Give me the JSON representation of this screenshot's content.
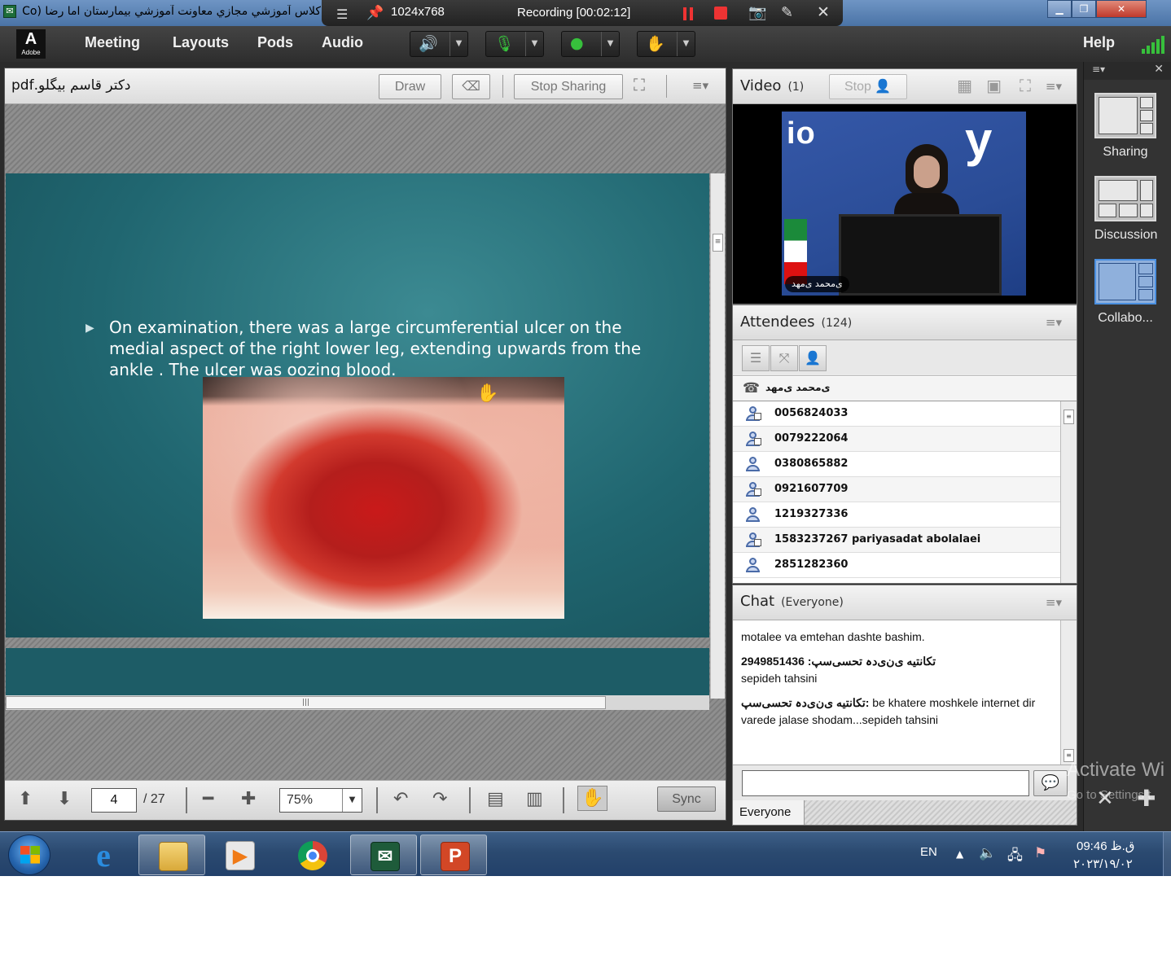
{
  "window": {
    "title": "كلاس آموزشي مجازي معاونت آموزشي بيمارستان اما رضا (Co",
    "controls": [
      "minimize",
      "maximize",
      "close"
    ]
  },
  "recorder": {
    "resolution": "1024x768",
    "status": "Recording [00:02:12]"
  },
  "menubar": {
    "logo_text": "Adobe",
    "items": [
      "Meeting",
      "Layouts",
      "Pods",
      "Audio"
    ],
    "help": "Help",
    "speaker_color": "#37c03c",
    "mic_color": "#37c03c",
    "camera_color": "#37c03c"
  },
  "share": {
    "title": "دکتر قاسم بیگلو.pdf",
    "draw_label": "Draw",
    "stop_sharing_label": "Stop Sharing",
    "slide_text": "On examination, there was a large circumferential ulcer on the medial aspect of the right lower leg, extending upwards from the ankle . The ulcer was oozing blood.",
    "page": "4",
    "page_total": "/ 27",
    "zoom": "75%",
    "sync_label": "Sync"
  },
  "video": {
    "title": "Video",
    "count": "(1)",
    "stop_label": "Stop",
    "feed_logo": "io",
    "feed_logo2": "y",
    "presenter_name": "ی‌محمد ی‌مهد"
  },
  "attendees": {
    "title": "Attendees",
    "count": "(124)",
    "presenter": "ی‌محمد ی‌مهد",
    "list": [
      {
        "name": "0056824033",
        "camera": true
      },
      {
        "name": "0079222064",
        "camera": true
      },
      {
        "name": "0380865882",
        "camera": false
      },
      {
        "name": "0921607709",
        "camera": true
      },
      {
        "name": "1219327336",
        "camera": false
      },
      {
        "name": "1583237267 pariyasadat abolalaei",
        "camera": true
      },
      {
        "name": "2851282360",
        "camera": false
      }
    ]
  },
  "chat": {
    "title": "Chat",
    "scope": "(Everyone)",
    "messages": [
      {
        "who": "",
        "text": "motalee va emtehan dashte bashim."
      },
      {
        "who": "سپی‌دہ تحسی‌نی 2949851436",
        "text": "سپی‌دہ تحسی‌نی: تکانتیه sepideh tahsini",
        "line1": "تکانتیه ی‌ن‌ی‌دہ تحسی‌سپ: 2949851436",
        "line2": "sepideh tahsini"
      },
      {
        "who": "تکانتیه ی‌ن‌ی‌دہ تحسی‌سپ:",
        "text": "be khatere moshkele internet dir varede jalase shodam...sepideh tahsini"
      }
    ],
    "target": "Everyone"
  },
  "layouts": {
    "items": [
      "Sharing",
      "Discussion",
      "Collabo..."
    ],
    "selected": 2
  },
  "watermark": {
    "line1": "Activate Wi",
    "line2": "Go to Settings t"
  },
  "taskbar": {
    "lang": "EN",
    "time": "09:46 ق.ظ",
    "date": "۲۰۲۳/۱۹/۰۲"
  }
}
